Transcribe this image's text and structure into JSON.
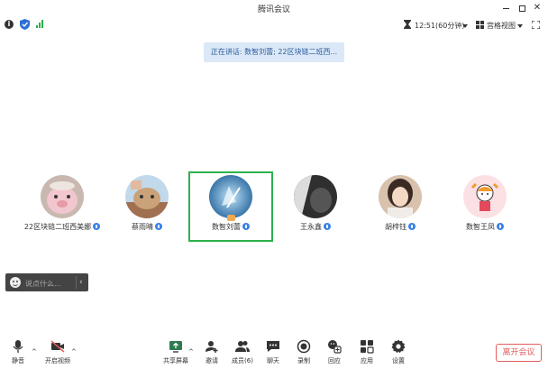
{
  "window": {
    "title": "腾讯会议"
  },
  "infobar": {
    "time": "12:51(60分钟)",
    "view_label": "宫格视图"
  },
  "speaking_banner": "正在讲话: 数智刘蕾; 22区块链二班西...",
  "participants": [
    {
      "name": "22区块链二班西美娜",
      "avatar_color": "#d9a9b4",
      "active": false
    },
    {
      "name": "蔡雨晴",
      "avatar_color": "#b8d4e6",
      "active": false
    },
    {
      "name": "数智刘蕾",
      "avatar_color": "#2e7fbf",
      "active": true
    },
    {
      "name": "王永鑫",
      "avatar_color": "#3a3a3a",
      "active": false
    },
    {
      "name": "胡梓钰",
      "avatar_color": "#c9a88f",
      "active": false
    },
    {
      "name": "数智王凤",
      "avatar_color": "#fbe0e4",
      "active": false
    }
  ],
  "chat": {
    "placeholder": "说点什么..."
  },
  "toolbar": {
    "mute_label": "静音",
    "video_label": "开启视频",
    "share_label": "共享屏幕",
    "invite_label": "邀请",
    "members_label": "成员(6)",
    "chat_label": "聊天",
    "record_label": "录制",
    "react_label": "回应",
    "apps_label": "应用",
    "settings_label": "设置",
    "leave_label": "离开会议"
  },
  "colors": {
    "accent_green": "#2bb24c",
    "leave_red": "#e35d5d",
    "banner_bg": "#dbe8f7",
    "mic_blue": "#3a82e8"
  }
}
